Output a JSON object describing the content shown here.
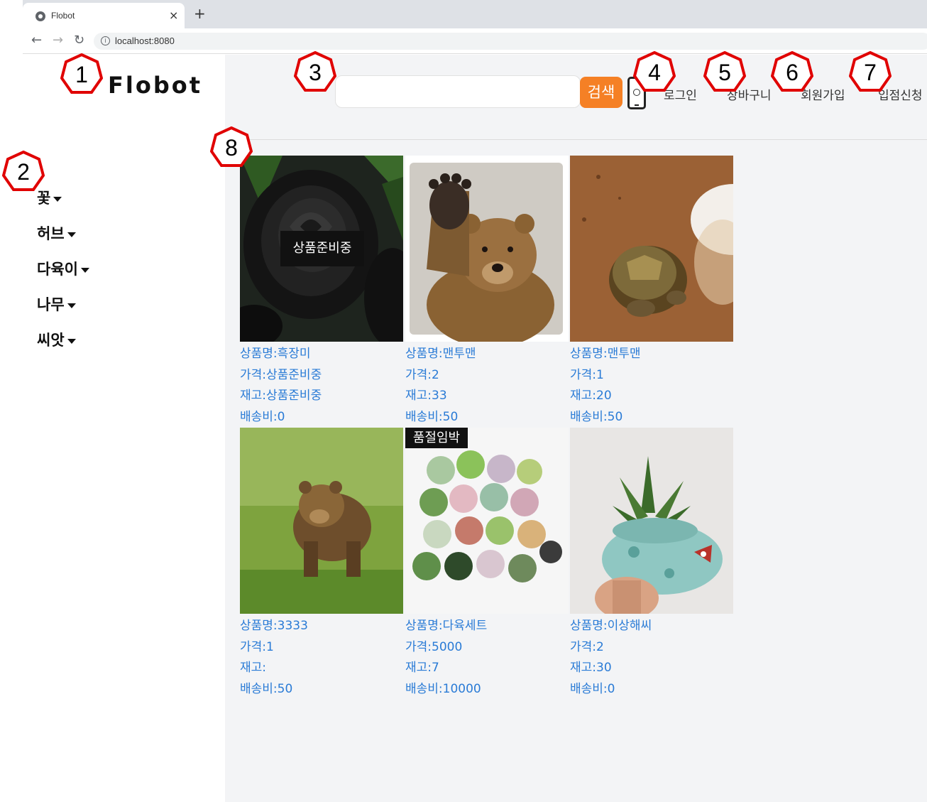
{
  "browser": {
    "tab_title": "Flobot",
    "tab_close": "×",
    "new_tab": "+",
    "url": "localhost:8080",
    "info": "i"
  },
  "logo": "Flobot",
  "categories": [
    {
      "label": "꽃"
    },
    {
      "label": "허브"
    },
    {
      "label": "다육이"
    },
    {
      "label": "나무"
    },
    {
      "label": "씨앗"
    }
  ],
  "header": {
    "search_button": "검색",
    "login": "로그인",
    "cart": "장바구니",
    "signup": "회원가입",
    "seller_apply": "입점신청"
  },
  "products": [
    {
      "name": "상품명:흑장미",
      "price": "가격:상품준비중",
      "stock": "재고:상품준비중",
      "shipping": "배송비:0",
      "badge": "상품준비중",
      "image": "black-rose"
    },
    {
      "name": "상품명:맨투맨",
      "price": "가격:2",
      "stock": "재고:33",
      "shipping": "배송비:50",
      "badge": "",
      "image": "bear-waving"
    },
    {
      "name": "상품명:맨투맨",
      "price": "가격:1",
      "stock": "재고:20",
      "shipping": "배송비:50",
      "badge": "",
      "image": "tortoise"
    },
    {
      "name": "상품명:3333",
      "price": "가격:1",
      "stock": "재고:",
      "shipping": "배송비:50",
      "badge": "",
      "image": "bear-grass"
    },
    {
      "name": "상품명:다육세트",
      "price": "가격:5000",
      "stock": "재고:7",
      "shipping": "배송비:10000",
      "badge": "품절임박",
      "image": "succulent-set"
    },
    {
      "name": "상품명:이상해씨",
      "price": "가격:2",
      "stock": "재고:30",
      "shipping": "배송비:0",
      "badge": "",
      "image": "bulbasaur-pot"
    }
  ],
  "markers": [
    "1",
    "2",
    "3",
    "4",
    "5",
    "6",
    "7",
    "8"
  ],
  "colors": {
    "search_button": "#f58025",
    "product_text": "#2a7bd6",
    "main_bg": "#f3f4f6"
  }
}
